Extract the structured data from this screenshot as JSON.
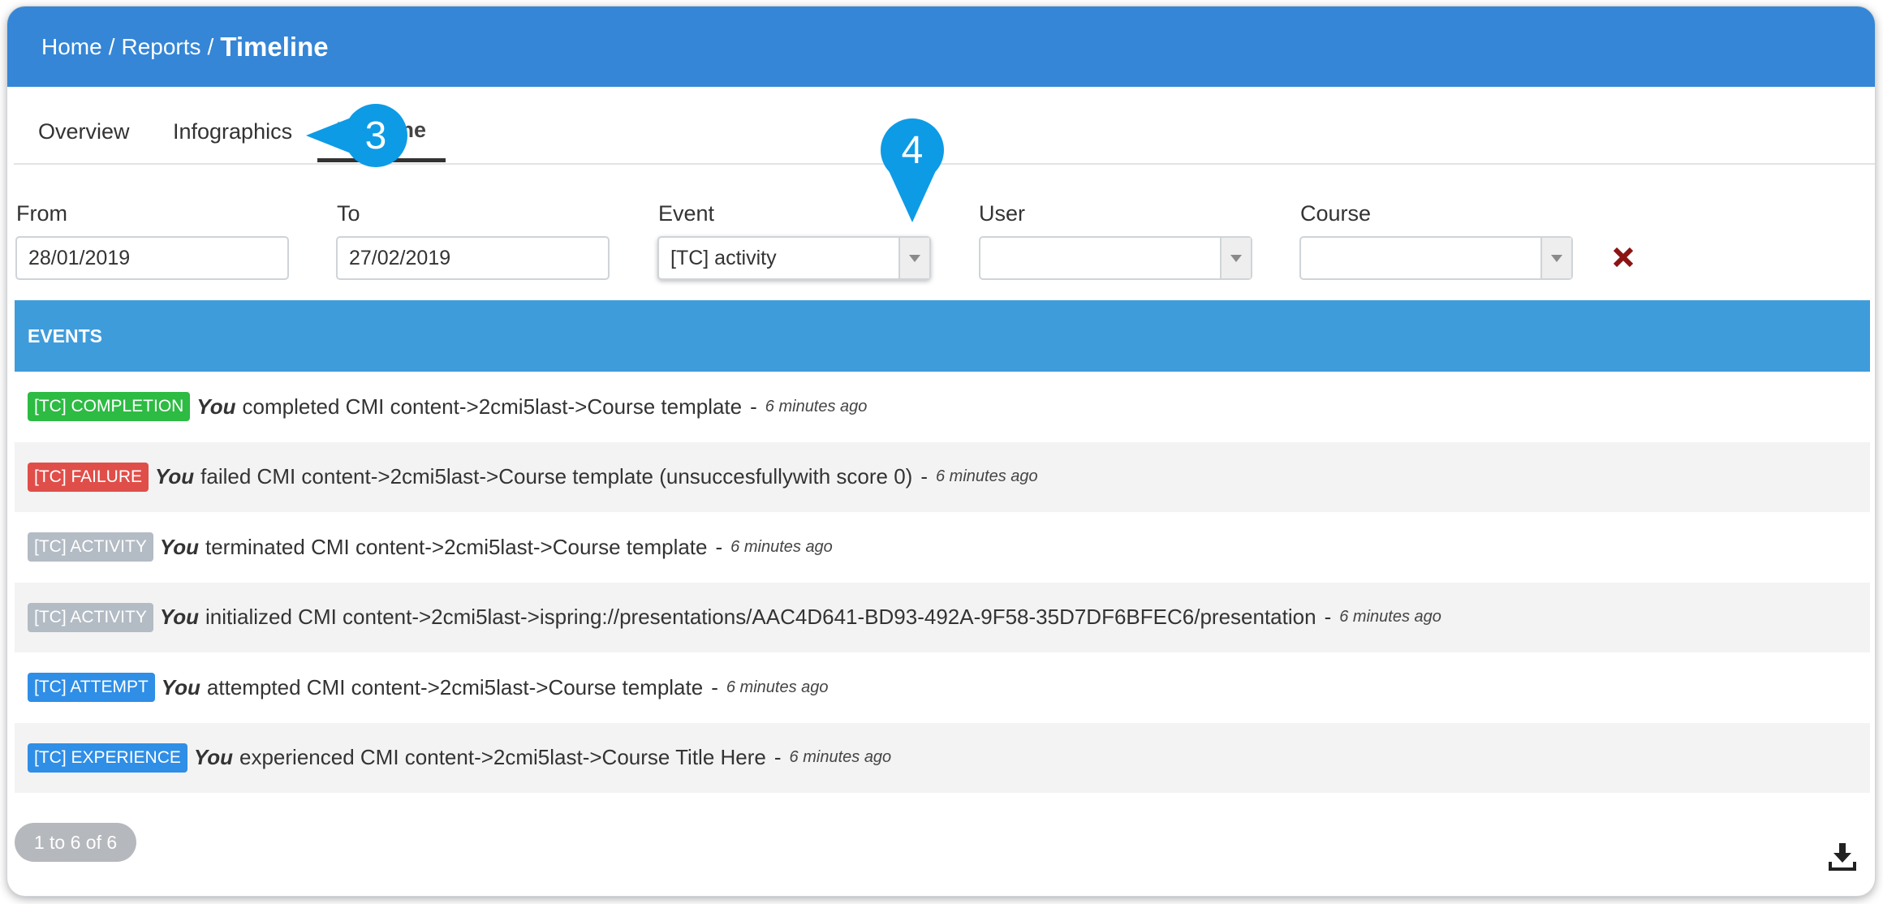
{
  "breadcrumb": {
    "home": "Home",
    "reports": "Reports",
    "current": "Timeline",
    "separator": "/"
  },
  "tabs": [
    {
      "label": "Overview",
      "active": false
    },
    {
      "label": "Infographics",
      "active": false
    },
    {
      "label": "Timeline",
      "active": true
    }
  ],
  "callouts": {
    "timeline_tab": "3",
    "event_filter": "4"
  },
  "filters": {
    "from": {
      "label": "From",
      "value": "28/01/2019"
    },
    "to": {
      "label": "To",
      "value": "27/02/2019"
    },
    "event": {
      "label": "Event",
      "value": "[TC] activity"
    },
    "user": {
      "label": "User",
      "value": ""
    },
    "course": {
      "label": "Course",
      "value": ""
    }
  },
  "events": {
    "header": "EVENTS",
    "rows": [
      {
        "badge": "[TC] COMPLETION",
        "badge_color": "#2dbb43",
        "who": "You",
        "text": "completed CMI content->2cmi5last->Course template",
        "ago": "6 minutes ago"
      },
      {
        "badge": "[TC] FAILURE",
        "badge_color": "#e04e4a",
        "who": "You",
        "text": "failed CMI content->2cmi5last->Course template (unsuccesfullywith score 0)",
        "ago": "6 minutes ago"
      },
      {
        "badge": "[TC] ACTIVITY",
        "badge_color": "#b3bbc4",
        "who": "You",
        "text": "terminated CMI content->2cmi5last->Course template",
        "ago": "6 minutes ago"
      },
      {
        "badge": "[TC] ACTIVITY",
        "badge_color": "#b3bbc4",
        "who": "You",
        "text": "initialized CMI content->2cmi5last->ispring://presentations/AAC4D641-BD93-492A-9F58-35D7DF6BFEC6/presentation",
        "ago": "6 minutes ago"
      },
      {
        "badge": "[TC] ATTEMPT",
        "badge_color": "#2f8ee6",
        "who": "You",
        "text": "attempted CMI content->2cmi5last->Course template",
        "ago": "6 minutes ago"
      },
      {
        "badge": "[TC] EXPERIENCE",
        "badge_color": "#2f8ee6",
        "who": "You",
        "text": "experienced CMI content->2cmi5last->Course Title Here",
        "ago": "6 minutes ago"
      }
    ]
  },
  "pagination": {
    "label": "1 to 6 of 6"
  },
  "colors": {
    "header_bg": "#3586d6",
    "events_header_bg": "#3f9cdb",
    "callout_bg": "#0d9be6",
    "clear_icon": "#8b1414"
  },
  "icons": {
    "clear": "close-x-icon",
    "download": "download-icon",
    "dropdown": "caret-down-icon"
  }
}
